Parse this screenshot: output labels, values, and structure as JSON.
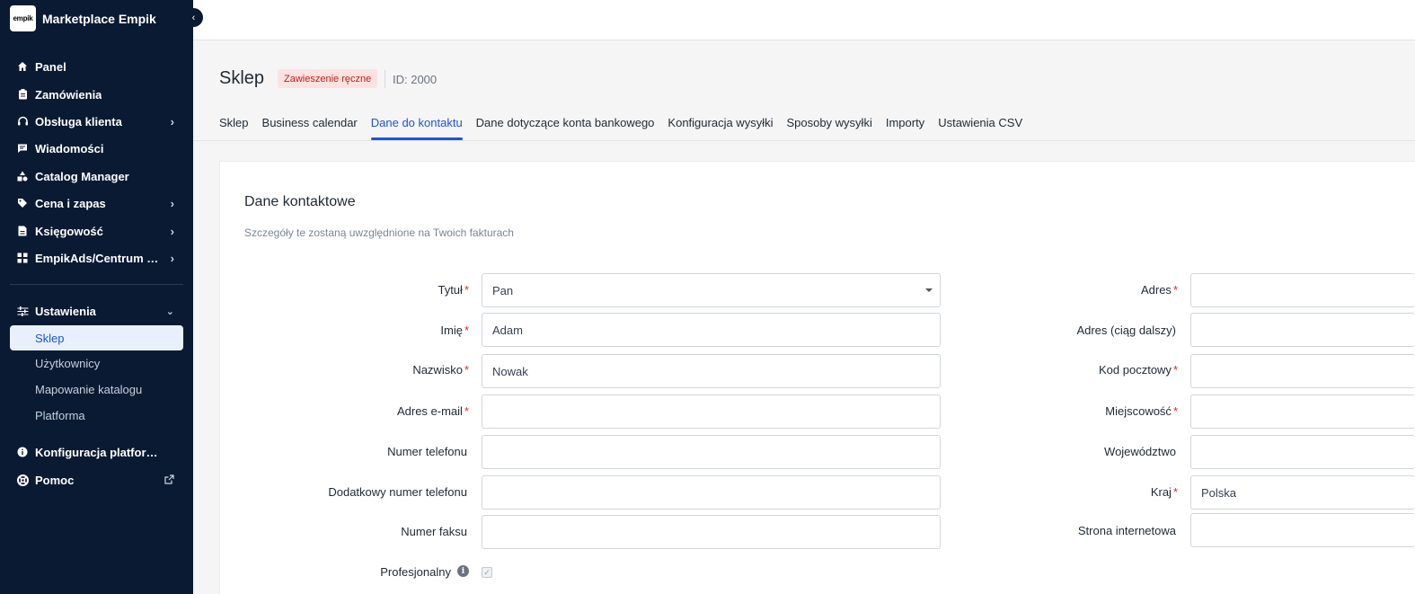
{
  "brand": {
    "logo_text": "empik",
    "name": "Marketplace Empik"
  },
  "sidebar": {
    "items": [
      {
        "label": "Panel",
        "icon": "home-icon"
      },
      {
        "label": "Zamówienia",
        "icon": "clipboard-icon"
      },
      {
        "label": "Obsługa klienta",
        "icon": "headset-icon"
      },
      {
        "label": "Wiadomości",
        "icon": "message-icon"
      },
      {
        "label": "Catalog Manager",
        "icon": "shapes-icon"
      },
      {
        "label": "Cena i zapas",
        "icon": "tag-icon"
      },
      {
        "label": "Księgowość",
        "icon": "invoice-icon"
      },
      {
        "label": "EmpikAds/Centrum Z...",
        "icon": "grid-icon"
      }
    ],
    "settings": {
      "label": "Ustawienia",
      "icon": "sliders-icon",
      "sub_items": [
        "Sklep",
        "Użytkownicy",
        "Mapowanie katalogu",
        "Platforma"
      ]
    },
    "bottom_items": [
      {
        "label": "Konfiguracja platformy",
        "icon": "info-icon"
      },
      {
        "label": "Pomoc",
        "icon": "lifebuoy-icon"
      }
    ]
  },
  "header": {
    "title": "Sklep",
    "badge": "Zawieszenie ręczne",
    "id_label": "ID: 2000"
  },
  "tabs": [
    "Sklep",
    "Business calendar",
    "Dane do kontaktu",
    "Dane dotyczące konta bankowego",
    "Konfiguracja wysyłki",
    "Sposoby wysyłki",
    "Importy",
    "Ustawienia CSV"
  ],
  "active_tab": "Dane do kontaktu",
  "card": {
    "title": "Dane kontaktowe",
    "subtitle": "Szczegóły te zostaną uwzględnione na Twoich fakturach"
  },
  "form_left": [
    {
      "label": "Tytuł",
      "required": "*",
      "value": "Pan"
    },
    {
      "label": "Imię",
      "required": "*",
      "value": "Adam"
    },
    {
      "label": "Nazwisko",
      "required": "*",
      "value": "Nowak"
    },
    {
      "label": "Adres e-mail",
      "required": "*",
      "value": ""
    },
    {
      "label": "Numer telefonu",
      "required": "",
      "value": ""
    },
    {
      "label": "Dodatkowy numer telefonu",
      "required": "",
      "value": ""
    },
    {
      "label": "Numer faksu",
      "required": "",
      "value": ""
    }
  ],
  "professional": {
    "label": "Profesjonalny",
    "checked": "✓"
  },
  "form_right": [
    {
      "label": "Adres",
      "required": "*",
      "value": ""
    },
    {
      "label": "Adres (ciąg dalszy)",
      "required": "",
      "value": ""
    },
    {
      "label": "Kod pocztowy",
      "required": "*",
      "value": ""
    },
    {
      "label": "Miejscowość",
      "required": "*",
      "value": ""
    },
    {
      "label": "Województwo",
      "required": "",
      "value": ""
    },
    {
      "label": "Kraj",
      "required": "*",
      "value": "Polska"
    },
    {
      "label": "Strona internetowa",
      "required": "",
      "value": ""
    }
  ]
}
